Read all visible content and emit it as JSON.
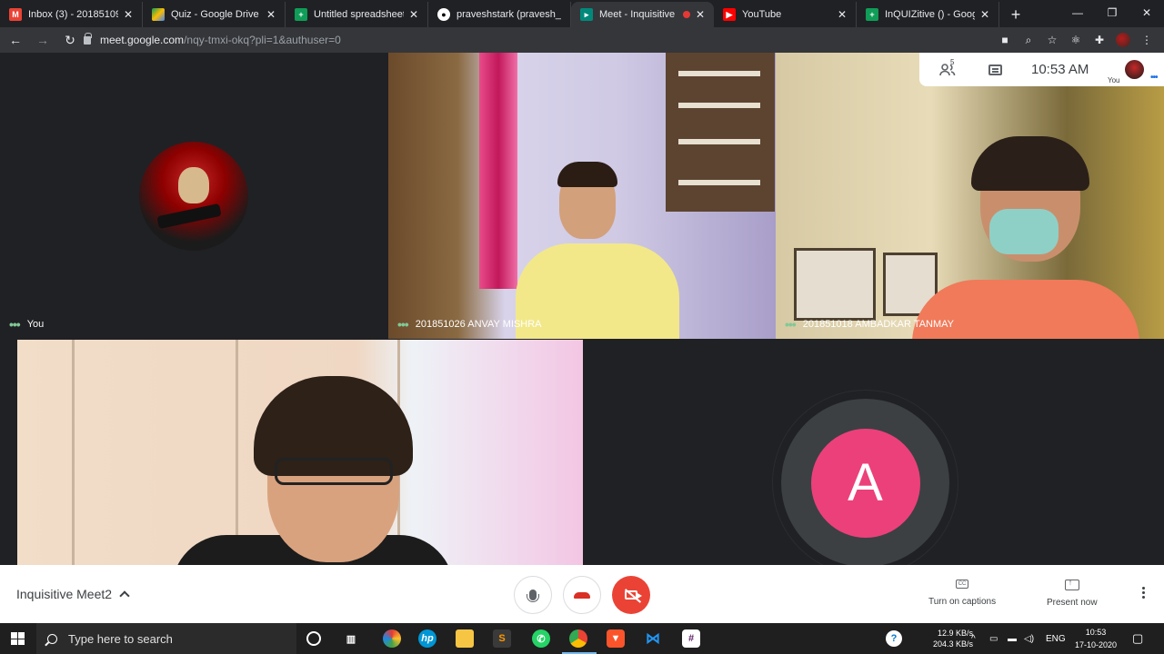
{
  "browser": {
    "tabs": [
      {
        "label": "Inbox (3) - 20185109…",
        "favicon": "gmail-icon",
        "color": "#ea4335",
        "active": false
      },
      {
        "label": "Quiz - Google Drive",
        "favicon": "drive-icon",
        "color": "#fbbc04",
        "active": false
      },
      {
        "label": "Untitled spreadsheet -",
        "favicon": "sheets-icon",
        "color": "#0f9d58",
        "active": false
      },
      {
        "label": "praveshstark (pravesh_",
        "favicon": "github-icon",
        "color": "#ffffff",
        "active": false
      },
      {
        "label": "Meet - Inquisitive",
        "favicon": "meet-icon",
        "color": "#00897b",
        "active": true
      },
      {
        "label": "YouTube",
        "favicon": "youtube-icon",
        "color": "#ff0000",
        "active": false
      },
      {
        "label": "InQUIZitive () - Google",
        "favicon": "sheets-icon",
        "color": "#0f9d58",
        "active": false
      }
    ],
    "url_host": "meet.google.com",
    "url_path": "/nqy-tmxi-okq?pli=1&authuser=0"
  },
  "meet": {
    "tiles": [
      {
        "name": "You"
      },
      {
        "name": "201851026 ANVAY MISHRA"
      },
      {
        "name": "201851018 AMBADKAR TANMAY"
      }
    ],
    "placeholder_initial": "A",
    "placeholder_color": "#ec407a",
    "info": {
      "participant_count": "5",
      "time": "10:53 AM",
      "self_label": "You"
    },
    "meeting_name": "Inquisitive Meet2",
    "actions": {
      "captions": "Turn on captions",
      "present": "Present now"
    }
  },
  "taskbar": {
    "search_placeholder": "Type here to search",
    "net_up": "12.9 KB/s",
    "net_down": "204.3 KB/s",
    "language": "ENG",
    "time": "10:53",
    "date": "17-10-2020"
  }
}
